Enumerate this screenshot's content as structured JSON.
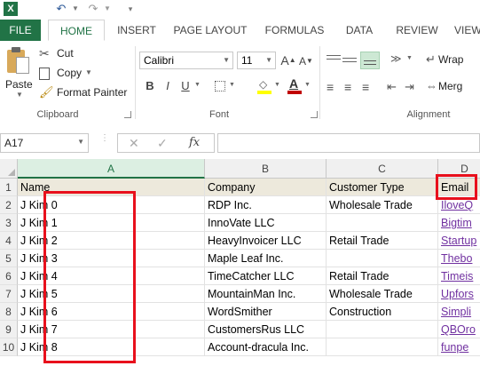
{
  "quick_access": {
    "app_icon": "excel-icon",
    "undo_icon": "undo-icon",
    "redo_icon": "redo-icon",
    "customize_icon": "customize-qat-icon"
  },
  "tabs": [
    {
      "label": "FILE"
    },
    {
      "label": "HOME"
    },
    {
      "label": "INSERT"
    },
    {
      "label": "PAGE LAYOUT"
    },
    {
      "label": "FORMULAS"
    },
    {
      "label": "DATA"
    },
    {
      "label": "REVIEW"
    },
    {
      "label": "VIEW"
    }
  ],
  "clipboard": {
    "paste_label": "Paste",
    "cut_label": "Cut",
    "copy_label": "Copy",
    "format_painter_label": "Format Painter",
    "group_label": "Clipboard"
  },
  "font": {
    "name": "Calibri",
    "size": "11",
    "group_label": "Font",
    "bold": "B",
    "italic": "I",
    "underline": "U",
    "font_color_letter": "A",
    "fill_color": "#ffff00",
    "font_color": "#c00000"
  },
  "alignment": {
    "wrap_label": "Wrap",
    "merge_label": "Merg",
    "group_label": "Alignment"
  },
  "formula_bar": {
    "name_box": "A17",
    "cancel": "✕",
    "enter": "✓",
    "fx": "fx",
    "value": ""
  },
  "grid": {
    "columns": [
      "A",
      "B",
      "C",
      "D"
    ],
    "selected_column": "A",
    "row_numbers": [
      "1",
      "2",
      "3",
      "4",
      "5",
      "6",
      "7",
      "8",
      "9",
      "10"
    ],
    "header_row": [
      "Name",
      "Company",
      "Customer Type",
      "Email"
    ],
    "rows": [
      [
        "J Kim 0",
        "RDP Inc.",
        "Wholesale Trade",
        "IloveQ"
      ],
      [
        "J Kim 1",
        "InnoVate LLC",
        "",
        "Bigtim"
      ],
      [
        "J Kim 2",
        "HeavyInvoicer LLC",
        "Retail Trade",
        "Startup"
      ],
      [
        "J Kim 3",
        "Maple Leaf Inc.",
        "",
        "Thebo"
      ],
      [
        "J Kim 4",
        "TimeCatcher LLC",
        "Retail Trade",
        "Timeis"
      ],
      [
        "J Kim 5",
        "MountainMan Inc.",
        "Wholesale Trade",
        "Upfors"
      ],
      [
        "J Kim 6",
        "WordSmither",
        "Construction",
        "Simpli"
      ],
      [
        "J Kim 7",
        "CustomersRus LLC",
        "",
        "QBOro"
      ],
      [
        "J Kim 8",
        "Account-dracula Inc.",
        "",
        "funpe"
      ]
    ]
  },
  "colors": {
    "accent": "#217346",
    "highlight_border": "#e8101c",
    "link": "#7030a0"
  }
}
